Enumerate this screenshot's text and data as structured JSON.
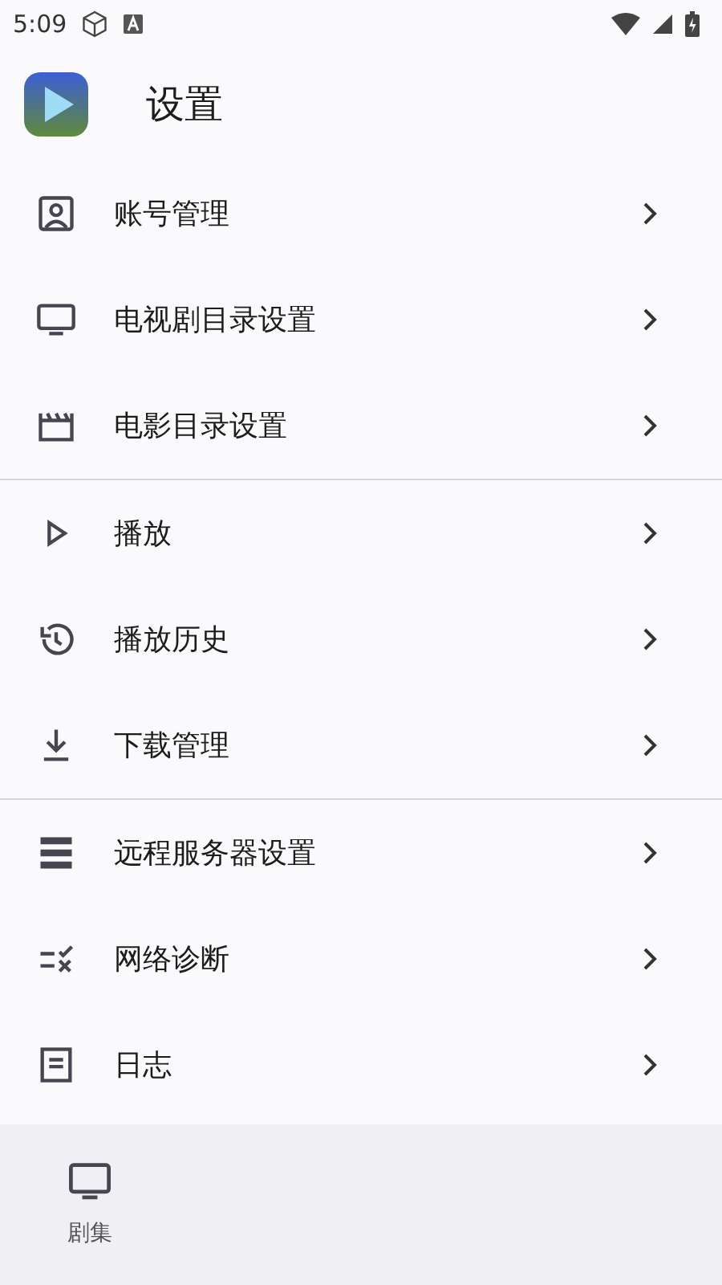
{
  "status_bar": {
    "time": "5:09"
  },
  "header": {
    "title": "设置"
  },
  "groups": [
    {
      "items": [
        {
          "label": "账号管理"
        },
        {
          "label": "电视剧目录设置"
        },
        {
          "label": "电影目录设置"
        }
      ]
    },
    {
      "items": [
        {
          "label": "播放"
        },
        {
          "label": "播放历史"
        },
        {
          "label": "下载管理"
        }
      ]
    },
    {
      "items": [
        {
          "label": "远程服务器设置"
        },
        {
          "label": "网络诊断"
        },
        {
          "label": "日志"
        }
      ]
    }
  ],
  "bottom_nav": {
    "items": [
      {
        "label": "剧集",
        "selected": false
      }
    ]
  }
}
